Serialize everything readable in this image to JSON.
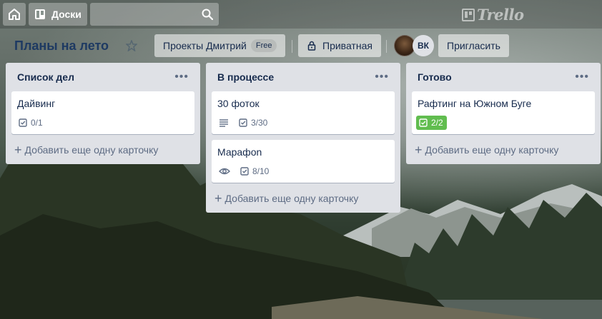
{
  "header": {
    "boards_label": "Доски",
    "logo_text": "Trello"
  },
  "board": {
    "title": "Планы на лето",
    "team_label": "Проекты Дмитрий",
    "team_plan": "Free",
    "visibility_label": "Приватная",
    "member_initials": "ВК",
    "invite_label": "Пригласить"
  },
  "lists": [
    {
      "title": "Список дел",
      "cards": [
        {
          "title": "Дайвинг",
          "checklist": "0/1"
        }
      ],
      "add_label": "Добавить еще одну карточку"
    },
    {
      "title": "В процессе",
      "cards": [
        {
          "title": "30 фоток",
          "checklist": "3/30",
          "icon": "description-icon"
        },
        {
          "title": "Марафоn",
          "checklist": "8/10",
          "icon": "watch-eye-icon"
        }
      ],
      "add_label": "Добавить еще одну карточку"
    },
    {
      "title": "Готово",
      "cards": [
        {
          "title": "Рафтинг на Южном Буге",
          "checklist": "2/2",
          "complete": true
        }
      ],
      "add_label": "Добавить еще одну карточку"
    }
  ],
  "colors": {
    "list_bg": "#dfe1e6",
    "complete_badge": "#61bd4f",
    "board_title": "#1e3a62"
  }
}
